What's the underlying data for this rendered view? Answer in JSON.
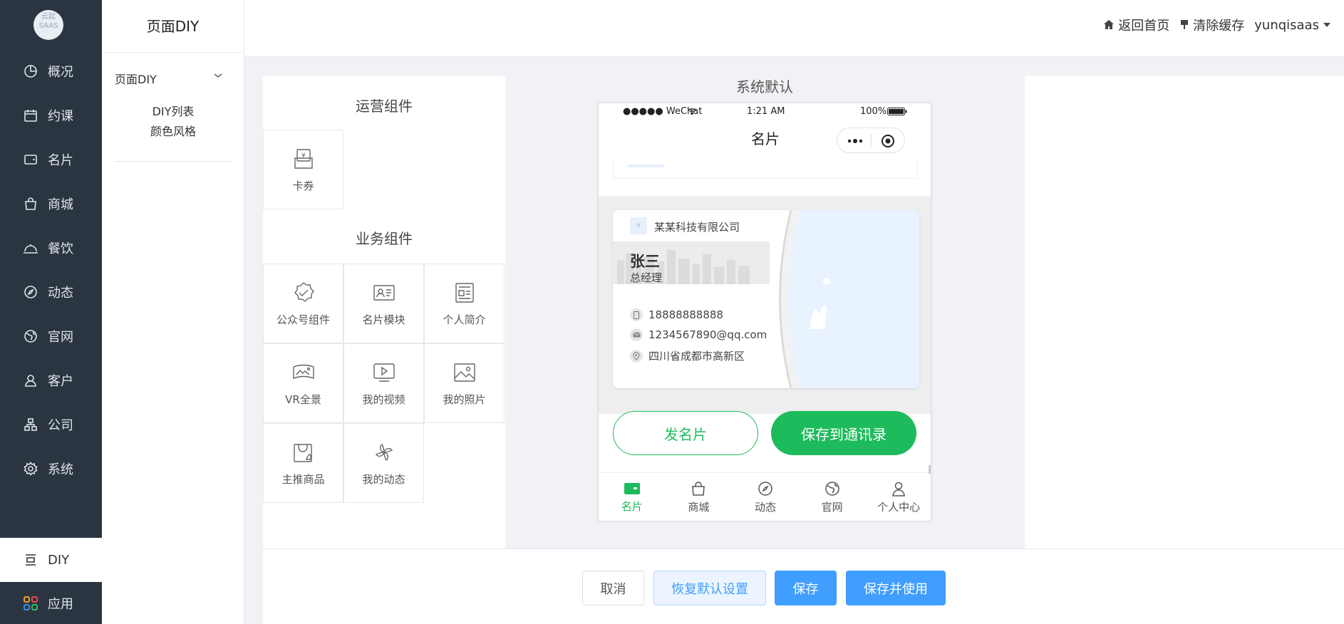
{
  "sidebar": {
    "logo_text": "云起 SAAS",
    "items": [
      {
        "label": "概况",
        "icon": "pie-chart-icon"
      },
      {
        "label": "约课",
        "icon": "calendar-icon"
      },
      {
        "label": "名片",
        "icon": "wallet-icon"
      },
      {
        "label": "商城",
        "icon": "shopping-bag-icon"
      },
      {
        "label": "餐饮",
        "icon": "cloche-icon"
      },
      {
        "label": "动态",
        "icon": "compass-icon"
      },
      {
        "label": "官网",
        "icon": "globe-icon"
      },
      {
        "label": "客户",
        "icon": "user-icon"
      },
      {
        "label": "公司",
        "icon": "org-chart-icon"
      },
      {
        "label": "系统",
        "icon": "gear-icon"
      }
    ],
    "diy": {
      "label": "DIY",
      "icon": "diy-icon"
    },
    "apps": {
      "label": "应用",
      "icon": "apps-grid-icon"
    }
  },
  "subnav": {
    "title": "页面DIY",
    "group_label": "页面DIY",
    "items": [
      "DIY列表",
      "颜色风格"
    ]
  },
  "topbar": {
    "home_label": "返回首页",
    "clear_cache_label": "清除缓存",
    "username": "yunqisaas"
  },
  "components": {
    "ops_title": "运营组件",
    "ops_items": [
      {
        "label": "卡券",
        "icon": "coupon-icon"
      }
    ],
    "biz_title": "业务组件",
    "biz_items": [
      {
        "label": "公众号组件",
        "icon": "badge-check-icon"
      },
      {
        "label": "名片模块",
        "icon": "id-card-icon"
      },
      {
        "label": "个人简介",
        "icon": "profile-doc-icon"
      },
      {
        "label": "VR全景",
        "icon": "vr-icon"
      },
      {
        "label": "我的视频",
        "icon": "video-icon"
      },
      {
        "label": "我的照片",
        "icon": "photo-icon"
      },
      {
        "label": "主推商品",
        "icon": "product-bag-icon"
      },
      {
        "label": "我的动态",
        "icon": "pinwheel-icon"
      }
    ]
  },
  "preview": {
    "title": "系统默认",
    "status": {
      "carrier": "●●●●● WeChat",
      "time": "1:21 AM",
      "battery": "100%"
    },
    "nav_title": "名片",
    "card": {
      "company": "某某科技有限公司",
      "name": "张三",
      "position": "总经理",
      "phone": "18888888888",
      "email": "1234567890@qq.com",
      "address": "四川省成都市高新区"
    },
    "btn_send": "发名片",
    "btn_save": "保存到通讯录",
    "tabs": [
      {
        "label": "名片",
        "icon": "card-tab-icon"
      },
      {
        "label": "商城",
        "icon": "bag-tab-icon"
      },
      {
        "label": "动态",
        "icon": "compass-tab-icon"
      },
      {
        "label": "官网",
        "icon": "globe-tab-icon"
      },
      {
        "label": "个人中心",
        "icon": "user-tab-icon"
      }
    ],
    "accent": "#1dbb5c"
  },
  "footer": {
    "cancel": "取消",
    "restore": "恢复默认设置",
    "save": "保存",
    "save_use": "保存并使用"
  },
  "colors": {
    "sidebar_bg": "#2a3541",
    "primary_blue": "#409eff",
    "green": "#1dbb5c"
  }
}
